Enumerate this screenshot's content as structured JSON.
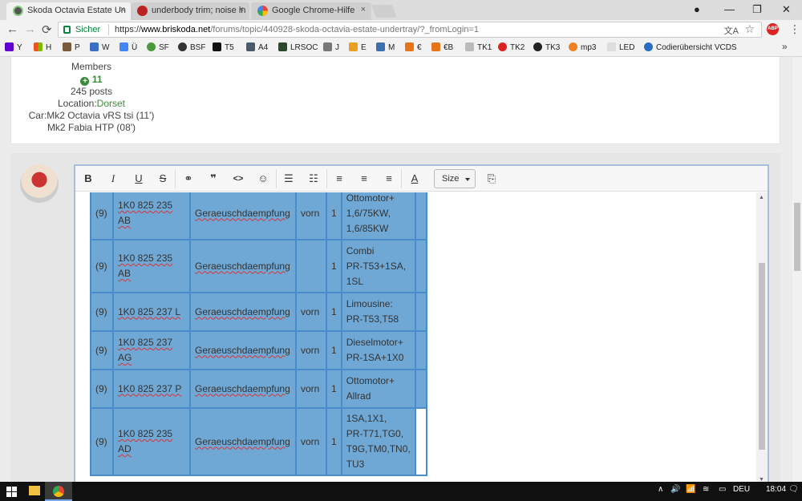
{
  "browser": {
    "tabs": [
      {
        "title": "Skoda Octavia Estate Un",
        "active": true
      },
      {
        "title": "underbody trim; noise in",
        "active": false
      },
      {
        "title": "Google Chrome-Hilfe",
        "active": false
      }
    ],
    "tab_close": "×",
    "window_controls": {
      "minimize": "—",
      "restore": "❐",
      "close": "✕",
      "profile": "●"
    },
    "nav": {
      "back": "←",
      "forward": "→",
      "reload": "⟳"
    },
    "address": {
      "secure_label": "Sicher",
      "url_scheme": "https://",
      "url_host": "www.briskoda.net",
      "url_path": "/forums/topic/440928-skoda-octavia-estate-undertray/?_fromLogin=1"
    },
    "star": "☆",
    "translate": "文A",
    "adblock": "ABP",
    "menu": "⋮"
  },
  "bookmarks": {
    "items": [
      "Y",
      "H",
      "P",
      "W",
      "Ü",
      "SF",
      "BSF",
      "T5",
      "A4",
      "LRSOC",
      "J",
      "E",
      "M",
      "€",
      "€B",
      "TK1",
      "TK2",
      "TK3",
      "mp3",
      "LED",
      "Codierübersicht VCDS"
    ],
    "more": "»"
  },
  "usercard": {
    "role": "Members",
    "reputation": "11",
    "posts": "245 posts",
    "location_label": "Location:",
    "location_value": "Dorset",
    "car_line1": "Car:Mk2 Octavia vRS tsi (11')",
    "car_line2": "Mk2 Fabia HTP (08')"
  },
  "toolbar": {
    "bold": "B",
    "italic": "I",
    "underline": "U",
    "strike": "S",
    "link": "⚭",
    "quote": "❞",
    "code": "<>",
    "emoji": "☺",
    "bullets": "☰",
    "numbered": "☷",
    "align_left": "≡",
    "align_center": "≡",
    "align_right": "≡",
    "text_color": "A",
    "size": "Size",
    "preview": "⎘"
  },
  "table": {
    "rows": [
      {
        "idx": "(9)",
        "part": "1K0 825 235 AB",
        "desc": "Geraeuschdaempfung",
        "pos": "vorn",
        "qty": "1",
        "note": [
          "Ottomotor+",
          "1,6/75KW,",
          "1,6/85KW"
        ]
      },
      {
        "idx": "(9)",
        "part": "1K0 825 235 AB",
        "desc": "Geraeuschdaempfung",
        "pos": "",
        "qty": "1",
        "note": [
          "Combi",
          "PR-T53+1SA,",
          "1SL"
        ]
      },
      {
        "idx": "(9)",
        "part": "1K0 825 237 L",
        "desc": "Geraeuschdaempfung",
        "pos": "vorn",
        "qty": "1",
        "note": [
          "Limousine:",
          "PR-T53,T58"
        ]
      },
      {
        "idx": "(9)",
        "part": "1K0 825 237 AG",
        "desc": "Geraeuschdaempfung",
        "pos": "vorn",
        "qty": "1",
        "note": [
          "Dieselmotor+",
          "PR-1SA+1X0"
        ]
      },
      {
        "idx": "(9)",
        "part": "1K0 825 237 P",
        "desc": "Geraeuschdaempfung",
        "pos": "vorn",
        "qty": "1",
        "note": [
          "Ottomotor+",
          "Allrad"
        ]
      },
      {
        "idx": "(9)",
        "part": "1K0 825 235 AD",
        "desc": "Geraeuschdaempfung",
        "pos": "vorn",
        "qty": "1",
        "note": [
          "1SA,1X1,",
          "PR-T71,TG0,",
          "T9G,TM0,TN0,",
          "TU3"
        ]
      }
    ]
  },
  "scroll": {
    "up": "▲",
    "down": "▼"
  },
  "taskbar": {
    "tray_arrow": "∧",
    "volume": "🔊",
    "network": "📶",
    "language": "DEU",
    "time": "18:04",
    "notifications": "🗨"
  }
}
